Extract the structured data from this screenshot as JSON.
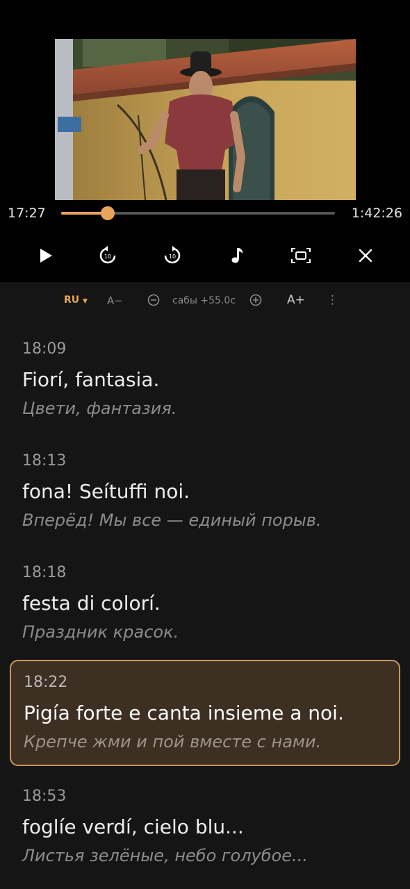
{
  "player": {
    "current_time": "17:27",
    "total_time": "1:42:26",
    "progress": 0.17
  },
  "controls": {
    "play": "play-icon",
    "rewind": "rewind-10-icon",
    "forward": "forward-10-icon",
    "audio": "music-note-icon",
    "screen": "fit-screen-icon",
    "close": "close-icon",
    "skip_label": "10"
  },
  "sub_toolbar": {
    "lang": "RU",
    "font_smaller": "A−",
    "offset_label": "сабы +55.0с",
    "font_larger": "A+",
    "more": "⋮"
  },
  "colors": {
    "accent": "#e8a55a",
    "active_bg": "#3d2f22",
    "active_border": "#c9985d"
  },
  "cues": [
    {
      "time": "18:09",
      "orig": "Fiorí, fantasia.",
      "trans": "Цвети, фантазия.",
      "active": false
    },
    {
      "time": "18:13",
      "orig": "fona! Seítuffi noi.",
      "trans": "Вперёд! Мы все — единый порыв.",
      "active": false
    },
    {
      "time": "18:18",
      "orig": "festa di colorí.",
      "trans": "Праздник красок.",
      "active": false
    },
    {
      "time": "18:22",
      "orig": "Pigía forte e canta insieme a noi.",
      "trans": "Крепче жми и пой вместе с нами.",
      "active": true
    },
    {
      "time": "18:53",
      "orig": "foglíe verdí, cielo blu...",
      "trans": "Листья зелёные, небо голубое...",
      "active": false
    }
  ]
}
